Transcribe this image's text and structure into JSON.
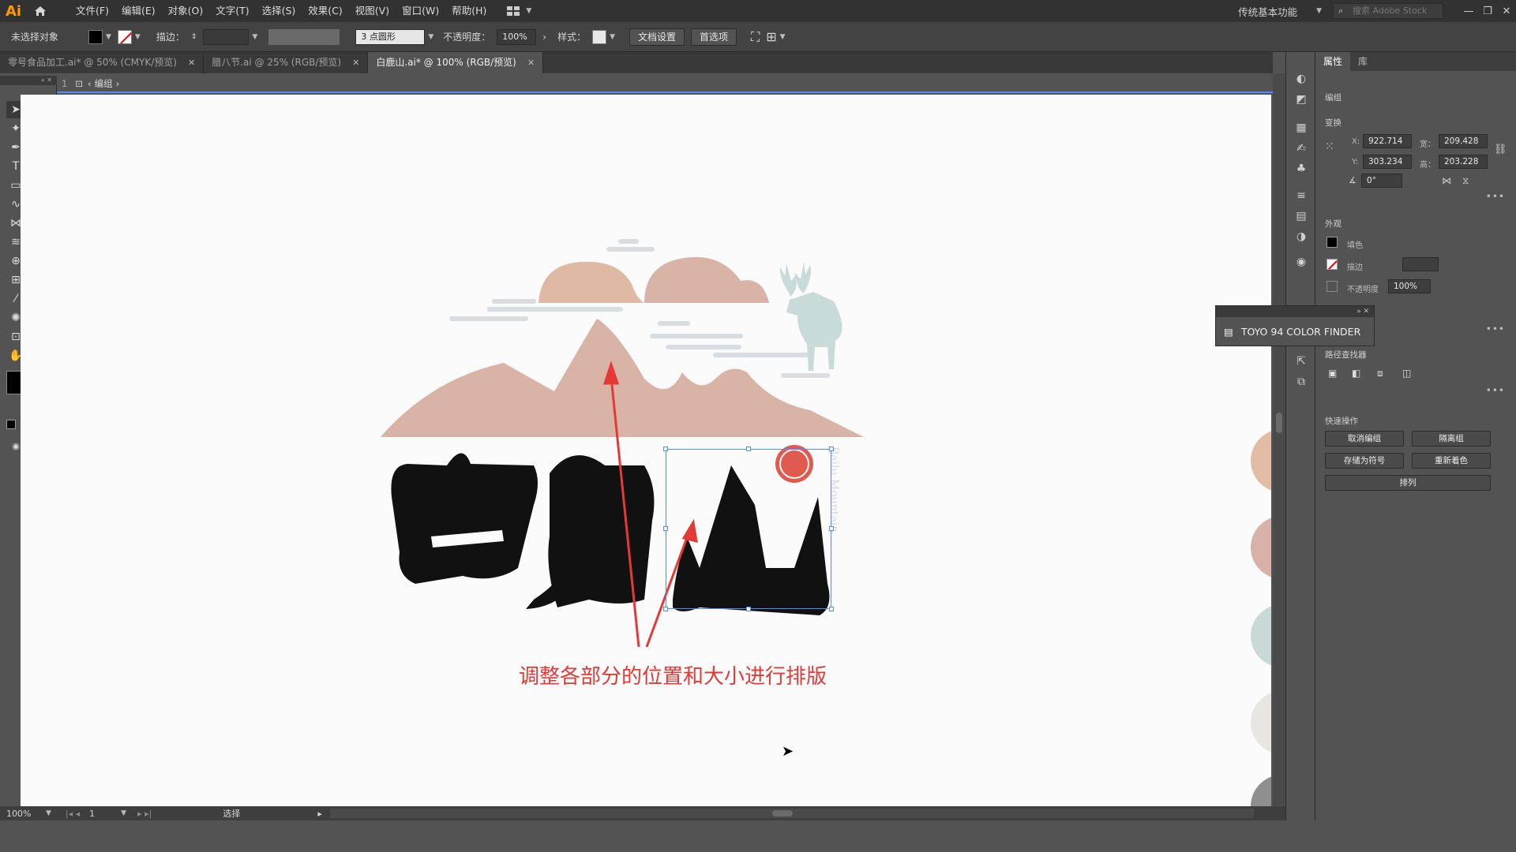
{
  "app": {
    "logo": "Ai",
    "menus": [
      "文件(F)",
      "编辑(E)",
      "对象(O)",
      "文字(T)",
      "选择(S)",
      "效果(C)",
      "视图(V)",
      "窗口(W)",
      "帮助(H)"
    ],
    "workspace": "传统基本功能",
    "stock_search_placeholder": "搜索 Adobe Stock"
  },
  "controlbar": {
    "selection": "未选择对象",
    "stroke_label": "描边：",
    "brush": "3 点圆形",
    "opacity_label": "不透明度：",
    "opacity_value": "100%",
    "style_label": "样式：",
    "doc_setup": "文档设置",
    "preferences": "首选项"
  },
  "tabs": [
    {
      "label": "零号食品加工.ai* @ 50% (CMYK/预览)",
      "active": false
    },
    {
      "label": "腊八节.ai @ 25% (RGB/预览)",
      "active": false
    },
    {
      "label": "白鹿山.ai* @ 100% (RGB/预览)",
      "active": true
    }
  ],
  "breadcrumb": {
    "layer": "1",
    "group": "编组"
  },
  "canvas": {
    "annotation": "调整各部分的位置和大小进行排版",
    "logo_text_chars": [
      "白",
      "鹿",
      "山"
    ],
    "seal_text": "白鹿山",
    "vertical_text": "Bailu Mountain"
  },
  "properties": {
    "tabs": [
      "属性",
      "库"
    ],
    "group_label": "编组",
    "transform_title": "变换",
    "x_label": "X:",
    "x_value": "922.714",
    "y_label": "Y:",
    "y_value": "303.234",
    "w_label": "宽：",
    "w_value": "209.428",
    "h_label": "高：",
    "h_value": "203.228",
    "angle_value": "0°",
    "appearance_title": "外观",
    "fill_label": "填色",
    "stroke_label": "描边",
    "opacity_label": "不透明度",
    "opacity_value": "100%",
    "pathfinder_title": "路径查找器",
    "quick_actions_title": "快速操作",
    "qa_ungroup": "取消编组",
    "qa_isolate": "隔离组",
    "qa_save_symbol": "存储为符号",
    "qa_recolor": "重新着色",
    "qa_arrange": "排列"
  },
  "floating_panel": {
    "title": "TOYO 94 COLOR FINDER"
  },
  "status": {
    "zoom": "100%",
    "page": "1",
    "tool": "选择"
  },
  "palette_colors": {
    "cloud": "#dfb9a3",
    "mountain": "#d9b3a6",
    "deer": "#c9dbd8",
    "circle1": "#e3bca5",
    "circle2": "#d8b1a8",
    "circle3": "#c9d9d6",
    "circle4": "#e7e6e0",
    "circle5": "#8f8f8f",
    "annotation": "#e53935",
    "arrow": "#e53935"
  }
}
